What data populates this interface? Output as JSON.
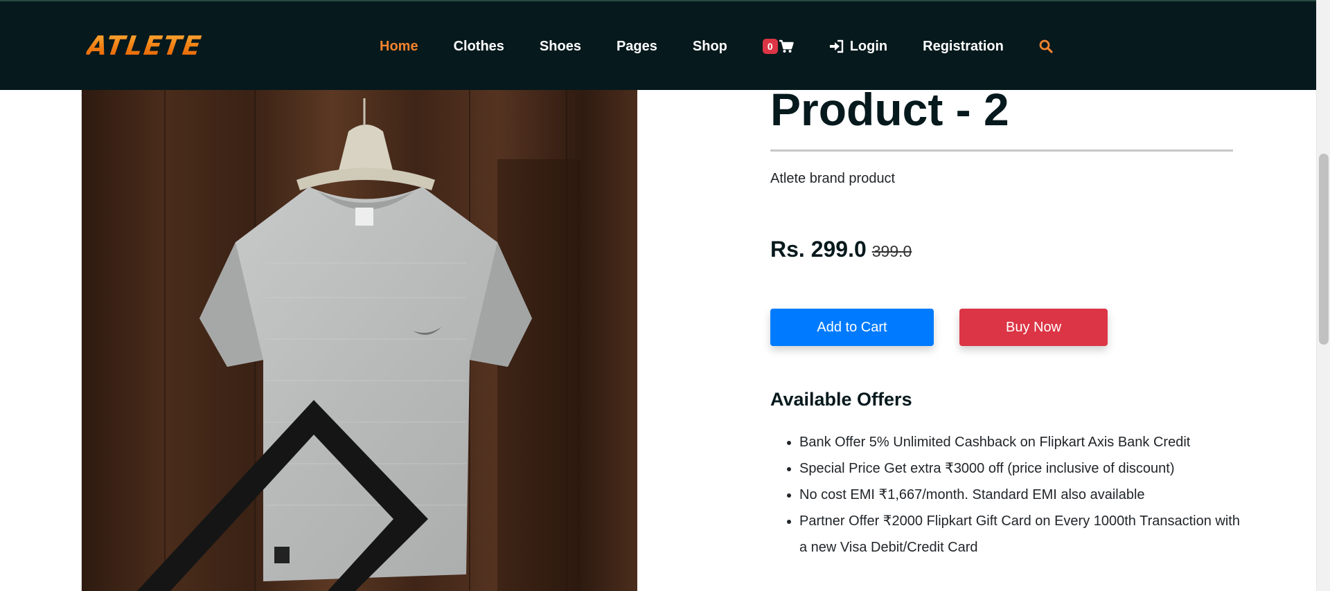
{
  "nav": {
    "logo": "ATLETE",
    "links": [
      {
        "label": "Home",
        "active": true
      },
      {
        "label": "Clothes"
      },
      {
        "label": "Shoes"
      },
      {
        "label": "Pages"
      },
      {
        "label": "Shop"
      }
    ],
    "cart_count": "0",
    "cart_icon": "shopping-cart-icon",
    "login_label": "Login",
    "login_icon": "sign-in-icon",
    "registration_label": "Registration",
    "search_icon": "search-icon",
    "accent_color": "#f3832d",
    "background_color": "#06191d"
  },
  "product": {
    "title": "Product - 2",
    "description": "Atlete brand product",
    "price": "Rs. 299.0",
    "old_price": "399.0",
    "add_to_cart_label": "Add to Cart",
    "buy_now_label": "Buy Now",
    "add_to_cart_color": "#007bff",
    "buy_now_color": "#dc3545"
  },
  "offers": {
    "heading": "Available Offers",
    "items": [
      "Bank Offer 5% Unlimited Cashback on Flipkart Axis Bank Credit",
      "Special Price Get extra ₹3000 off (price inclusive of discount)",
      "No cost EMI ₹1,667/month. Standard EMI also available",
      "Partner Offer ₹2000 Flipkart Gift Card on Every 1000th Transaction with a new Visa Debit/Credit Card"
    ]
  }
}
